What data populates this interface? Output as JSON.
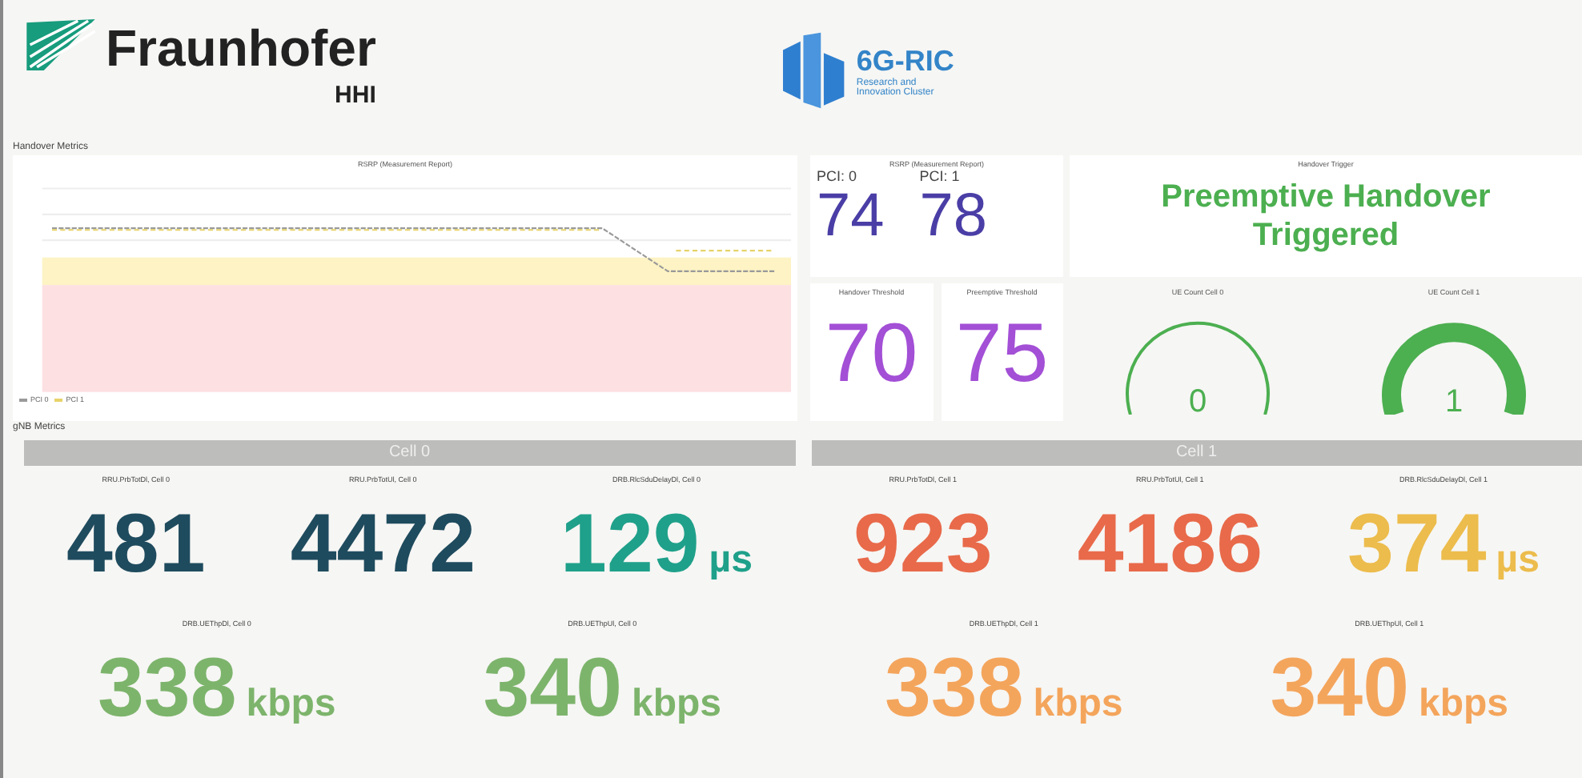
{
  "header": {
    "org_name": "Fraunhofer",
    "org_unit": "HHI",
    "cluster_name": "6G-RIC",
    "cluster_subtitle": [
      "Research and",
      "Innovation Cluster"
    ]
  },
  "handover": {
    "title": "Handover Metrics",
    "chart": {
      "title": "RSRP (Measurement Report)",
      "legend": [
        {
          "label": "PCI 0",
          "color": "#9a9a9a"
        },
        {
          "label": "PCI 1",
          "color": "#e8d36a"
        }
      ]
    },
    "rsrp": {
      "title": "RSRP (Measurement Report)",
      "items": [
        {
          "label": "PCI: 0",
          "value": "74"
        },
        {
          "label": "PCI: 1",
          "value": "78"
        }
      ]
    },
    "trigger": {
      "title": "Handover Trigger",
      "text": "Preemptive Handover Triggered"
    },
    "thresholds": [
      {
        "title": "Handover Threshold",
        "value": "70"
      },
      {
        "title": "Preemptive Threshold",
        "value": "75"
      }
    ],
    "gauges": [
      {
        "title": "UE Count Cell 0",
        "value": "0",
        "kind": "outline"
      },
      {
        "title": "UE Count Cell 1",
        "value": "1",
        "kind": "filled"
      }
    ]
  },
  "gnb": {
    "title": "gNB Metrics",
    "cells": [
      {
        "header": "Cell 0",
        "row1": [
          {
            "label": "RRU.PrbTotDl, Cell 0",
            "value": "481",
            "color": "#1f4b5e"
          },
          {
            "label": "RRU.PrbTotUl, Cell 0",
            "value": "4472",
            "color": "#1f4b5e"
          },
          {
            "label": "DRB.RlcSduDelayDl, Cell 0",
            "value": "129",
            "unit": "µs",
            "color": "#1fa08a"
          }
        ],
        "row2": [
          {
            "label": "DRB.UEThpDl, Cell 0",
            "value": "338",
            "unit": "kbps",
            "color": "#7db46c"
          },
          {
            "label": "DRB.UEThpUl, Cell 0",
            "value": "340",
            "unit": "kbps",
            "color": "#7db46c"
          }
        ]
      },
      {
        "header": "Cell 1",
        "row1": [
          {
            "label": "RRU.PrbTotDl, Cell 1",
            "value": "923",
            "color": "#e86a4a"
          },
          {
            "label": "RRU.PrbTotUl, Cell 1",
            "value": "4186",
            "color": "#e86a4a"
          },
          {
            "label": "DRB.RlcSduDelayDl, Cell 1",
            "value": "374",
            "unit": "µs",
            "color": "#ecbc4c"
          }
        ],
        "row2": [
          {
            "label": "DRB.UEThpDl, Cell 1",
            "value": "338",
            "unit": "kbps",
            "color": "#f4a55c"
          },
          {
            "label": "DRB.UEThpUl, Cell 1",
            "value": "340",
            "unit": "kbps",
            "color": "#f4a55c"
          }
        ]
      }
    ]
  }
}
